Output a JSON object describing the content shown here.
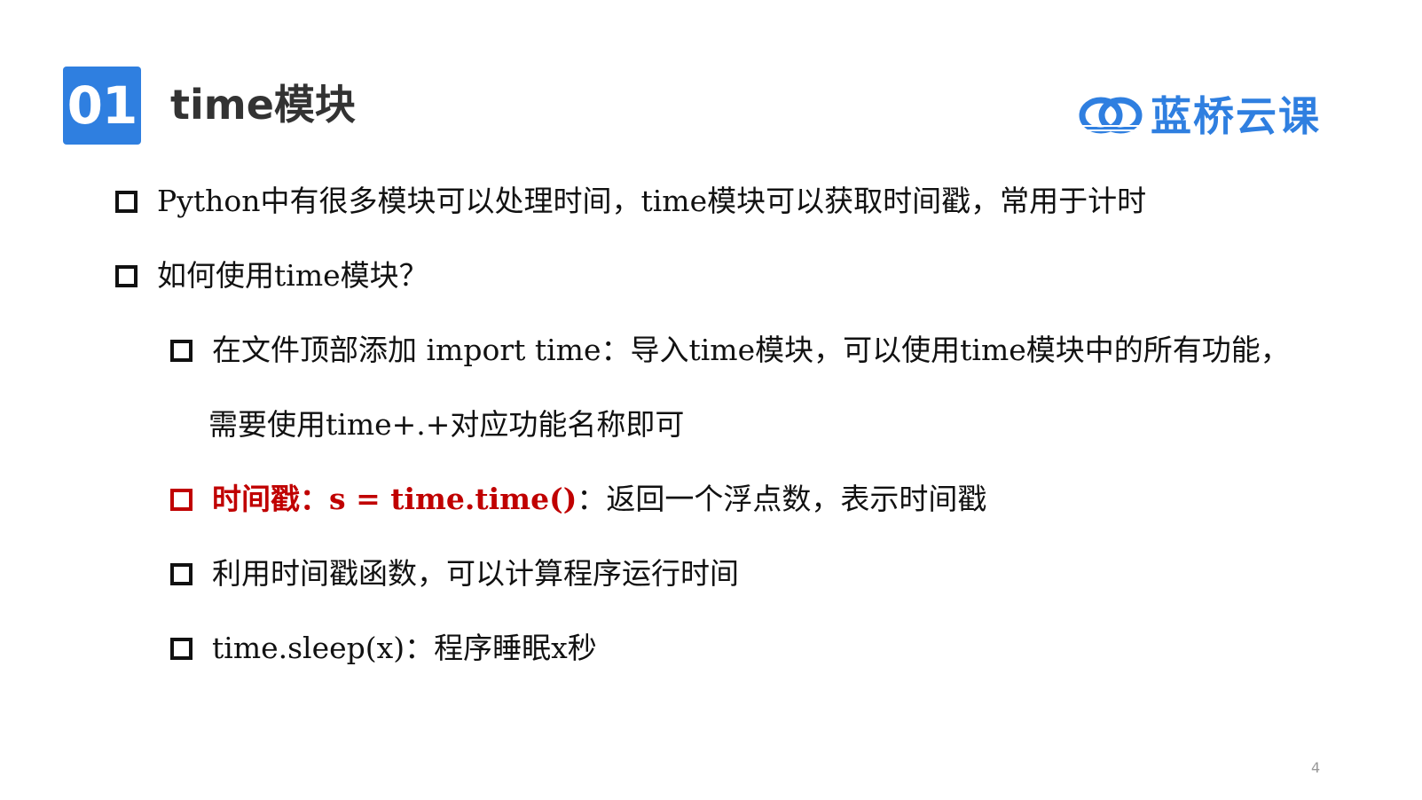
{
  "section": {
    "number": "01",
    "title": "time模块"
  },
  "brand": {
    "name": "蓝桥云课",
    "logo_icon": "swirl-logo-icon",
    "color": "#2f7fe0"
  },
  "bullets": [
    {
      "text": "Python中有很多模块可以处理时间，time模块可以获取时间戳，常用于计时"
    },
    {
      "text": "如何使用time模块？"
    },
    {
      "line1": "在文件顶部添加 import time：导入time模块，可以使用time模块中的所有功能，",
      "line2": "需要使用time+.+对应功能名称即可"
    },
    {
      "highlight": "时间戳：s = time.time()",
      "rest": "：返回一个浮点数，表示时间戳",
      "highlight_color": "#c00000"
    },
    {
      "text": "利用时间戳函数，可以计算程序运行时间"
    },
    {
      "text": "time.sleep(x)：程序睡眠x秒"
    }
  ],
  "page_number": "4"
}
